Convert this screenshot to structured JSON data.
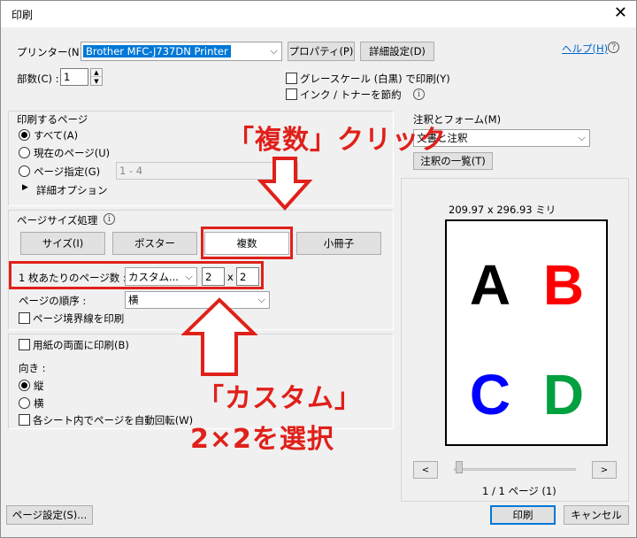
{
  "window": {
    "title": "印刷"
  },
  "header": {
    "printer_label": "プリンター(N) :",
    "printer_value": "Brother MFC-J737DN Printer",
    "properties_button": "プロパティ(P)",
    "advanced_button": "詳細設定(D)",
    "help_link": "ヘルプ(H)",
    "copies_label": "部数(C) :",
    "copies_value": "1",
    "grayscale_label": "グレースケール (白黒) で印刷(Y)",
    "save_ink_label": "インク / トナーを節約"
  },
  "pages_to_print": {
    "title": "印刷するページ",
    "all": "すべて(A)",
    "current": "現在のページ(U)",
    "range": "ページ指定(G)",
    "range_value": "1 - 4",
    "more_options": "詳細オプション"
  },
  "page_sizing": {
    "title": "ページサイズ処理",
    "buttons": [
      "サイズ(I)",
      "ポスター",
      "複数",
      "小冊子"
    ],
    "pages_per_sheet_label": "1 枚あたりのページ数 :",
    "pages_per_sheet_value": "カスタム...",
    "cols": "2",
    "x_sep": "x",
    "rows": "2",
    "order_label": "ページの順序 :",
    "order_value": "横",
    "print_border": "ページ境界線を印刷"
  },
  "duplex": {
    "label": "用紙の両面に印刷(B)"
  },
  "orientation": {
    "title": "向き :",
    "portrait": "縦",
    "landscape": "横",
    "auto_rotate": "各シート内でページを自動回転(W)"
  },
  "comments": {
    "title": "注釈とフォーム(M)",
    "value": "文書と注釈",
    "summary_button": "注釈の一覧(T)"
  },
  "preview": {
    "size": "209.97 x 296.93 ミリ",
    "letters": [
      "A",
      "B",
      "C",
      "D"
    ],
    "letter_colors": [
      "#000000",
      "#ff0000",
      "#0000ff",
      "#00a040"
    ],
    "prev": "<",
    "next": ">",
    "page_indicator": "1 / 1 ページ (1)"
  },
  "footer": {
    "page_setup": "ページ設定(S)...",
    "print": "印刷",
    "cancel": "キャンセル"
  },
  "annotations": {
    "click_multiple": "「複数」クリック",
    "custom_line1": "「カスタム」",
    "custom_line2": "2×2を選択",
    "color": "#e0201a"
  }
}
